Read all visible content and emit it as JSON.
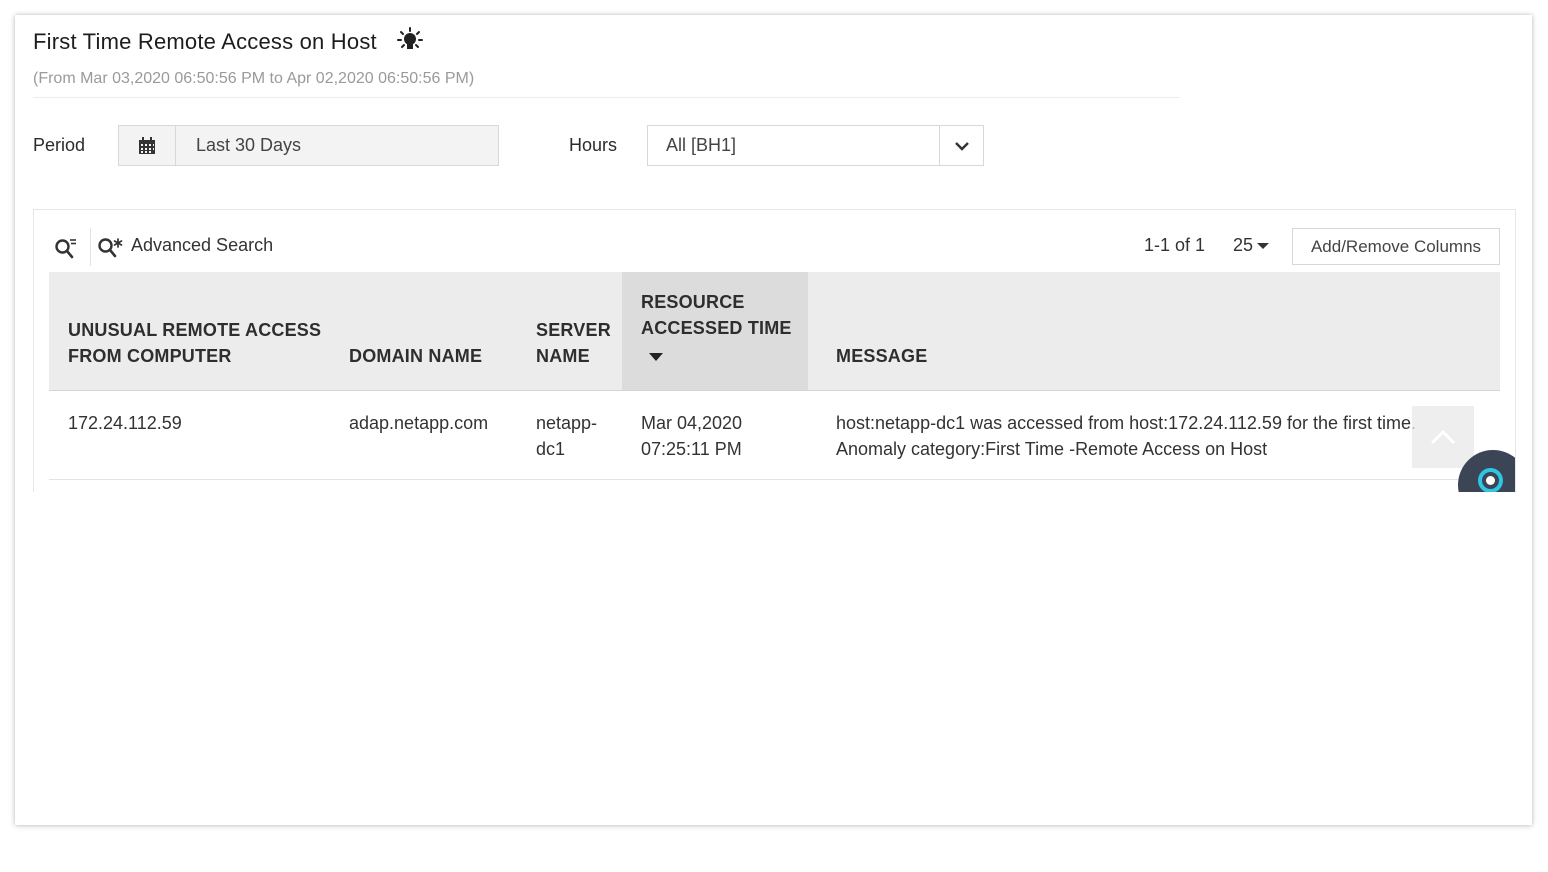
{
  "report": {
    "title": "First Time Remote Access on Host",
    "date_range": "(From Mar 03,2020 06:50:56 PM to Apr 02,2020 06:50:56 PM)",
    "bulb_icon": "lightbulb-icon"
  },
  "filters": {
    "period_label": "Period",
    "period_value": "Last 30 Days",
    "hours_label": "Hours",
    "hours_value": "All [BH1]"
  },
  "toolbar": {
    "advanced_search_label": "Advanced Search",
    "pagination": "1-1 of 1",
    "page_size": "25",
    "add_remove_columns_label": "Add/Remove Columns"
  },
  "table": {
    "columns": [
      {
        "line1": "UNUSUAL REMOTE ACCESS",
        "line2": "FROM COMPUTER"
      },
      {
        "line1": "",
        "line2": "DOMAIN NAME"
      },
      {
        "line1": "SERVER",
        "line2": "NAME"
      },
      {
        "line1": "RESOURCE",
        "line2": "ACCESSED TIME",
        "sorted": "descending"
      },
      {
        "line1": "",
        "line2": "MESSAGE"
      }
    ],
    "rows": [
      {
        "computer": "172.24.112.59",
        "domain": "adap.netapp.com",
        "server_line1": "netapp-",
        "server_line2": "dc1",
        "time_line1": "Mar 04,2020",
        "time_line2": "07:25:11 PM",
        "message_line1": "host:netapp-dc1 was accessed from host:172.24.112.59 for the first time.",
        "message_line2": "Anomaly category:First Time -Remote Access on Host"
      }
    ]
  },
  "colors": {
    "header_bg": "#ececec",
    "sorted_header_bg": "#dcdcdc",
    "chat_bg": "#3b4556",
    "chat_accent": "#2fc6e4",
    "notification": "#e94343"
  }
}
